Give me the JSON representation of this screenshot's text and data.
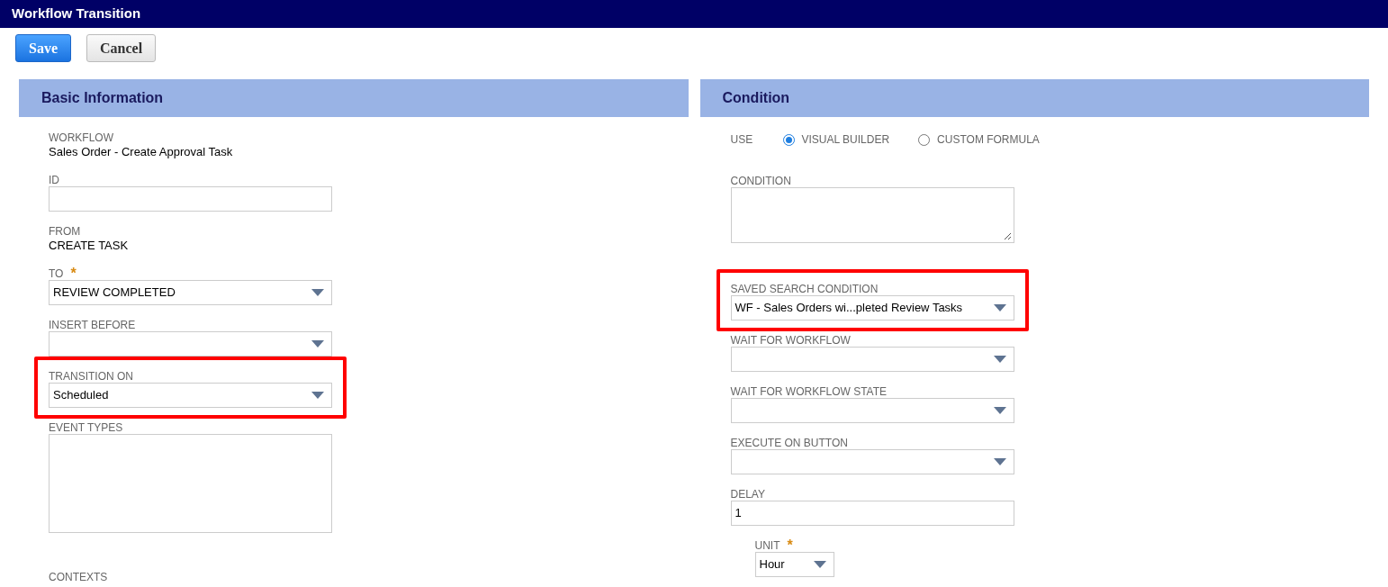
{
  "window": {
    "title": "Workflow Transition"
  },
  "buttons": [
    {
      "label": "Save",
      "kind": "primary"
    },
    {
      "label": "Cancel",
      "kind": "secondary"
    }
  ],
  "sections": [
    {
      "title": "Basic Information",
      "fields": [
        {
          "kind": "static",
          "label": "WORKFLOW",
          "value": "Sales Order - Create Approval Task"
        },
        {
          "kind": "text",
          "label": "ID"
        },
        {
          "kind": "static",
          "label": "FROM",
          "value": "CREATE TASK"
        },
        {
          "kind": "select",
          "label": "TO",
          "required_mark": "*",
          "value": "REVIEW COMPLETED"
        },
        {
          "kind": "select",
          "label": "INSERT BEFORE"
        },
        {
          "kind": "select",
          "label": "TRANSITION ON",
          "value": "Scheduled",
          "highlighted": true
        },
        {
          "kind": "textarea",
          "label": "EVENT TYPES",
          "tall": true
        },
        {
          "kind": "label",
          "label": "CONTEXTS"
        }
      ]
    },
    {
      "title": "Condition",
      "fields": [
        {
          "kind": "radio",
          "label": "USE",
          "options": [
            {
              "label": "VISUAL BUILDER",
              "selected": true
            },
            {
              "label": "CUSTOM FORMULA",
              "selected": false
            }
          ]
        },
        {
          "kind": "textarea",
          "label": "CONDITION",
          "resizable": true
        },
        {
          "kind": "select",
          "label": "SAVED SEARCH CONDITION",
          "value": "WF - Sales Orders wi...pleted Review Tasks",
          "highlighted": true
        },
        {
          "kind": "select",
          "label": "WAIT FOR WORKFLOW"
        },
        {
          "kind": "select",
          "label": "WAIT FOR WORKFLOW STATE"
        },
        {
          "kind": "select",
          "label": "EXECUTE ON BUTTON"
        },
        {
          "kind": "text",
          "label": "DELAY",
          "value": "1"
        },
        {
          "kind": "select",
          "label": "UNIT",
          "required_mark": "*",
          "value": "Hour",
          "narrow": true
        }
      ]
    }
  ]
}
